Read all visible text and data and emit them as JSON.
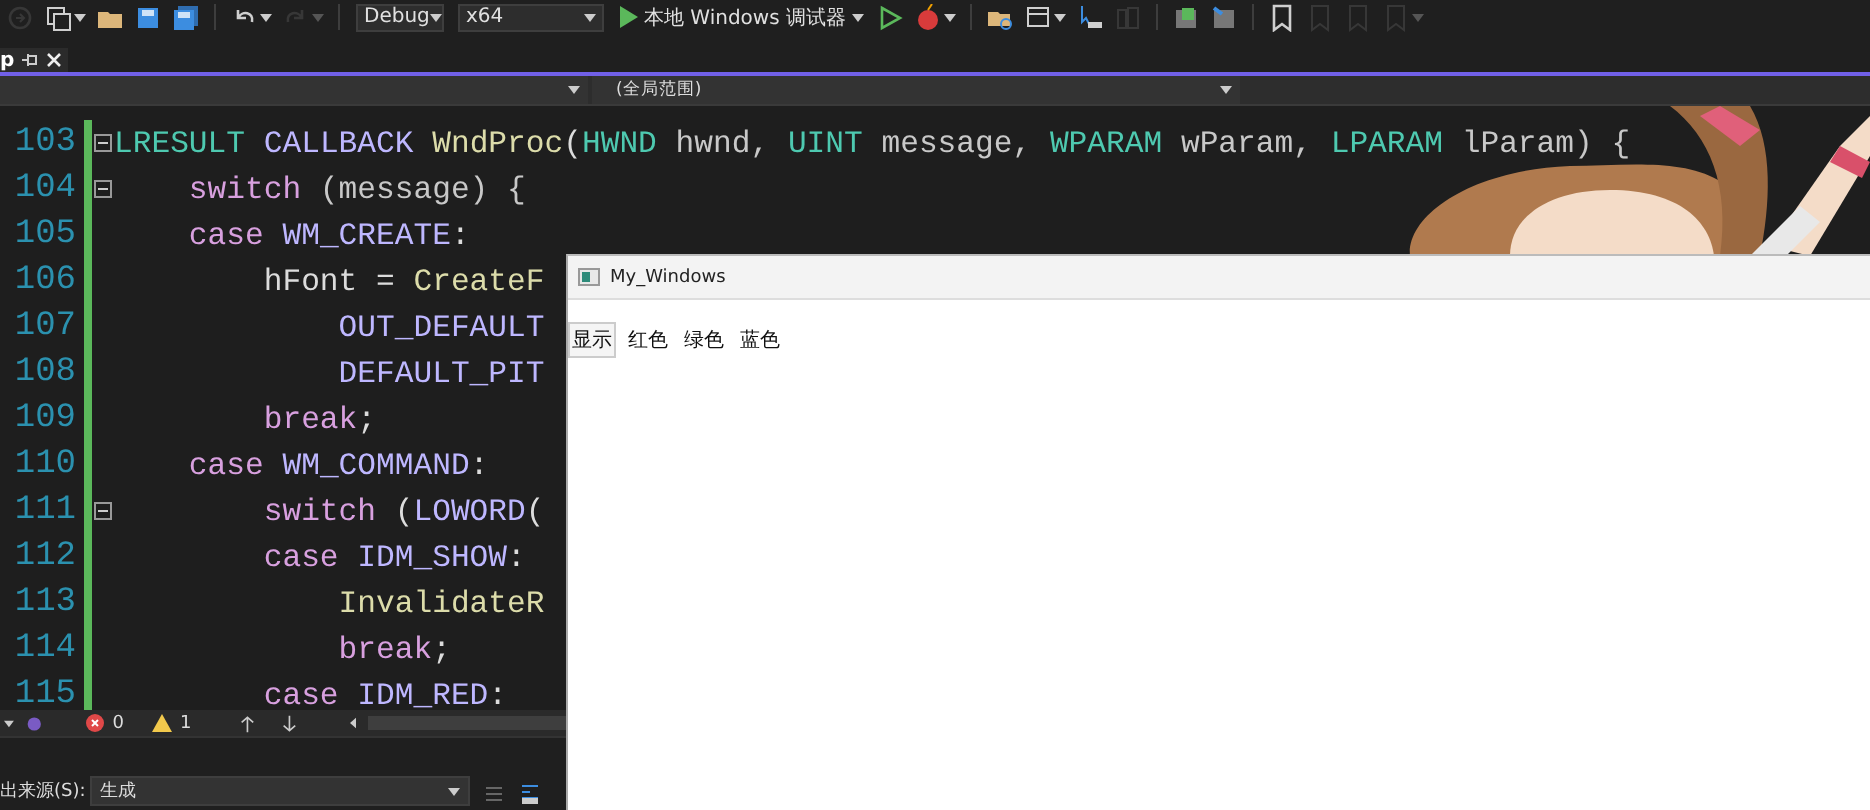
{
  "toolbar": [
    {
      "kind": "icon",
      "disabled": true
    },
    {
      "kind": "icon",
      "disabled": false,
      "dropdown": true
    },
    {
      "kind": "icon",
      "disabled": false
    },
    {
      "kind": "icon",
      "disabled": false
    },
    {
      "kind": "icon",
      "disabled": false
    },
    {
      "kind": "separator"
    },
    {
      "kind": "icon",
      "disabled": false,
      "dropdown": true
    },
    {
      "kind": "icon",
      "disabled": true,
      "dropdown": true
    },
    {
      "kind": "separator"
    },
    {
      "kind": "combo",
      "value": "Debug"
    },
    {
      "kind": "combo",
      "value": "x64"
    },
    {
      "kind": "run",
      "label": "本地 Windows 调试器",
      "dropdown": true
    },
    {
      "kind": "icon",
      "disabled": false
    },
    {
      "kind": "icon",
      "disabled": false,
      "dropdown": true
    },
    {
      "kind": "separator"
    },
    {
      "kind": "icon",
      "disabled": false
    },
    {
      "kind": "icon",
      "disabled": false,
      "dropdown": true
    },
    {
      "kind": "icon",
      "disabled": false
    },
    {
      "kind": "icon",
      "disabled": true
    },
    {
      "kind": "separator"
    },
    {
      "kind": "icon",
      "disabled": false
    },
    {
      "kind": "icon",
      "disabled": false
    },
    {
      "kind": "separator"
    },
    {
      "kind": "icon",
      "disabled": false
    },
    {
      "kind": "icon",
      "disabled": true
    },
    {
      "kind": "icon",
      "disabled": true
    },
    {
      "kind": "icon",
      "disabled": true,
      "dropdown": true
    }
  ],
  "tab": {
    "label": "p",
    "selected": true
  },
  "navigation": {
    "members": "(全局范围)"
  },
  "editor": {
    "lines": [
      {
        "number": "103",
        "fold": true,
        "tokens": [
          {
            "t": "LRESULT",
            "kind": "type"
          },
          {
            "t": " CALLBACK",
            "kind": "macro"
          },
          {
            "t": " WndProc",
            "kind": "func"
          },
          {
            "t": "(",
            "kind": "plain"
          },
          {
            "t": "HWND",
            "kind": "type"
          },
          {
            "t": " hwnd, ",
            "kind": "param"
          },
          {
            "t": "UINT",
            "kind": "type"
          },
          {
            "t": " message, ",
            "kind": "param"
          },
          {
            "t": "WPARAM",
            "kind": "type"
          },
          {
            "t": " wParam, ",
            "kind": "param"
          },
          {
            "t": "LPARAM",
            "kind": "type"
          },
          {
            "t": " lParam) {",
            "kind": "param"
          }
        ]
      },
      {
        "number": "104",
        "fold": true,
        "tokens": [
          {
            "t": "    switch",
            "kind": "keyword"
          },
          {
            "t": " (message) {",
            "kind": "param"
          }
        ]
      },
      {
        "number": "105",
        "fold": false,
        "tokens": [
          {
            "t": "    case",
            "kind": "keyword"
          },
          {
            "t": " WM_CREATE",
            "kind": "macro"
          },
          {
            "t": ":",
            "kind": "plain"
          }
        ]
      },
      {
        "number": "106",
        "fold": false,
        "tokens": [
          {
            "t": "        hFont = ",
            "kind": "plain"
          },
          {
            "t": "CreateF",
            "kind": "func"
          }
        ]
      },
      {
        "number": "107",
        "fold": false,
        "tokens": [
          {
            "t": "            OUT_DEFAULT",
            "kind": "macro"
          }
        ]
      },
      {
        "number": "108",
        "fold": false,
        "tokens": [
          {
            "t": "            DEFAULT_PIT",
            "kind": "macro"
          }
        ]
      },
      {
        "number": "109",
        "fold": false,
        "tokens": [
          {
            "t": "        break",
            "kind": "keyword"
          },
          {
            "t": ";",
            "kind": "plain"
          }
        ]
      },
      {
        "number": "110",
        "fold": false,
        "tokens": [
          {
            "t": "    case",
            "kind": "keyword"
          },
          {
            "t": " WM_COMMAND",
            "kind": "macro"
          },
          {
            "t": ":",
            "kind": "plain"
          }
        ]
      },
      {
        "number": "111",
        "fold": true,
        "tokens": [
          {
            "t": "        switch",
            "kind": "keyword"
          },
          {
            "t": " (",
            "kind": "plain"
          },
          {
            "t": "LOWORD",
            "kind": "macro"
          },
          {
            "t": "(",
            "kind": "plain"
          }
        ]
      },
      {
        "number": "112",
        "fold": false,
        "tokens": [
          {
            "t": "        case",
            "kind": "keyword"
          },
          {
            "t": " IDM_SHOW",
            "kind": "macro"
          },
          {
            "t": ":",
            "kind": "plain"
          }
        ]
      },
      {
        "number": "113",
        "fold": false,
        "tokens": [
          {
            "t": "            InvalidateR",
            "kind": "func"
          }
        ]
      },
      {
        "number": "114",
        "fold": false,
        "tokens": [
          {
            "t": "            break",
            "kind": "keyword"
          },
          {
            "t": ";",
            "kind": "plain"
          }
        ]
      },
      {
        "number": "115",
        "fold": false,
        "tokens": [
          {
            "t": "        case",
            "kind": "keyword"
          },
          {
            "t": " IDM_RED",
            "kind": "macro"
          },
          {
            "t": ":",
            "kind": "plain"
          }
        ]
      }
    ]
  },
  "status_bar": {
    "errors": "0",
    "warnings": "1"
  },
  "output": {
    "label": "出来源(S):",
    "source": "生成"
  },
  "app_window": {
    "title": "My_Windows",
    "menu": [
      {
        "label": "显示",
        "selected": true
      },
      {
        "label": "红色",
        "selected": false
      },
      {
        "label": "绿色",
        "selected": false
      },
      {
        "label": "蓝色",
        "selected": false
      }
    ]
  }
}
